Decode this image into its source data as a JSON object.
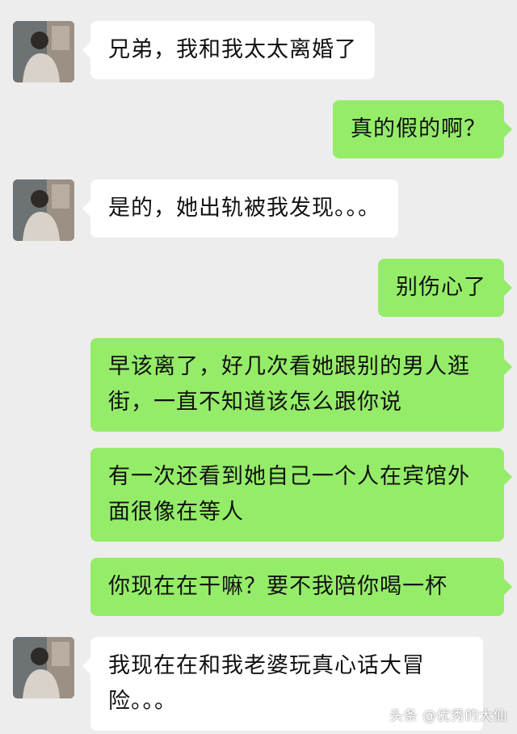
{
  "messages": [
    {
      "side": "in",
      "text": "兄弟，我和我太太离婚了"
    },
    {
      "side": "out",
      "text": "真的假的啊？"
    },
    {
      "side": "in",
      "text": "是的，她出轨被我发现。。。"
    },
    {
      "side": "out",
      "text": "别伤心了"
    },
    {
      "side": "out",
      "text": "早该离了，好几次看她跟别的男人逛街，一直不知道该怎么跟你说"
    },
    {
      "side": "out",
      "text": "有一次还看到她自己一个人在宾馆外面很像在等人"
    },
    {
      "side": "out",
      "text": "你现在在干嘛？要不我陪你喝一杯"
    },
    {
      "side": "in",
      "text": "我现在在和我老婆玩真心话大冒险。。。"
    }
  ],
  "watermark": "头条 @优秀的大仙",
  "colors": {
    "background": "#ededed",
    "incoming_bubble": "#ffffff",
    "outgoing_bubble": "#95ec69"
  },
  "icons": {
    "avatar": "contact-avatar"
  }
}
